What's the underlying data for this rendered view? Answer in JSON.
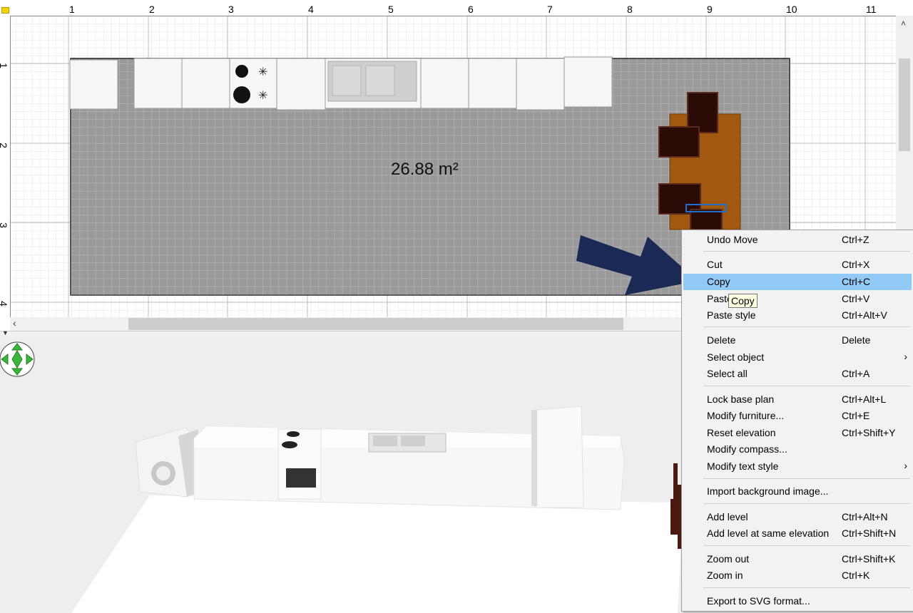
{
  "plan": {
    "ruler_top": [
      "1",
      "2",
      "3",
      "4",
      "5",
      "6",
      "7",
      "8",
      "9",
      "10",
      "11"
    ],
    "ruler_left": [
      "1",
      "2",
      "3",
      "4"
    ],
    "room_area": "26.88 m²"
  },
  "scroll": {
    "left_arrow": "‹",
    "up_arrow": "˄",
    "splitter_arrow": "▼"
  },
  "context_menu": {
    "items": [
      {
        "label": "Undo Move",
        "shortcut": "Ctrl+Z"
      },
      {
        "label": "Cut",
        "shortcut": "Ctrl+X"
      },
      {
        "label": "Copy",
        "shortcut": "Ctrl+C"
      },
      {
        "label": "Paste",
        "shortcut": "Ctrl+V"
      },
      {
        "label": "Paste style",
        "shortcut": "Ctrl+Alt+V"
      },
      {
        "label": "Delete",
        "shortcut": "Delete"
      },
      {
        "label": "Select object",
        "shortcut": "",
        "submenu": "›"
      },
      {
        "label": "Select all",
        "shortcut": "Ctrl+A"
      },
      {
        "label": "Lock base plan",
        "shortcut": "Ctrl+Alt+L"
      },
      {
        "label": "Modify furniture...",
        "shortcut": "Ctrl+E"
      },
      {
        "label": "Reset elevation",
        "shortcut": "Ctrl+Shift+Y"
      },
      {
        "label": "Modify compass...",
        "shortcut": ""
      },
      {
        "label": "Modify text style",
        "shortcut": "",
        "submenu": "›"
      },
      {
        "label": "Import background image...",
        "shortcut": ""
      },
      {
        "label": "Add level",
        "shortcut": "Ctrl+Alt+N"
      },
      {
        "label": "Add level at same elevation",
        "shortcut": "Ctrl+Shift+N"
      },
      {
        "label": "Zoom out",
        "shortcut": "Ctrl+Shift+K"
      },
      {
        "label": "Zoom in",
        "shortcut": "Ctrl+K"
      },
      {
        "label": "Export to SVG format...",
        "shortcut": ""
      }
    ],
    "highlighted": "Copy"
  },
  "tooltip": "Copy",
  "colors": {
    "room_floor": "#9a9a9a",
    "table": "#a0590f",
    "chair": "#2b0b05",
    "menu_highlight": "#91c9f7",
    "arrow": "#1a2a55",
    "compass": "#3bb53b"
  }
}
